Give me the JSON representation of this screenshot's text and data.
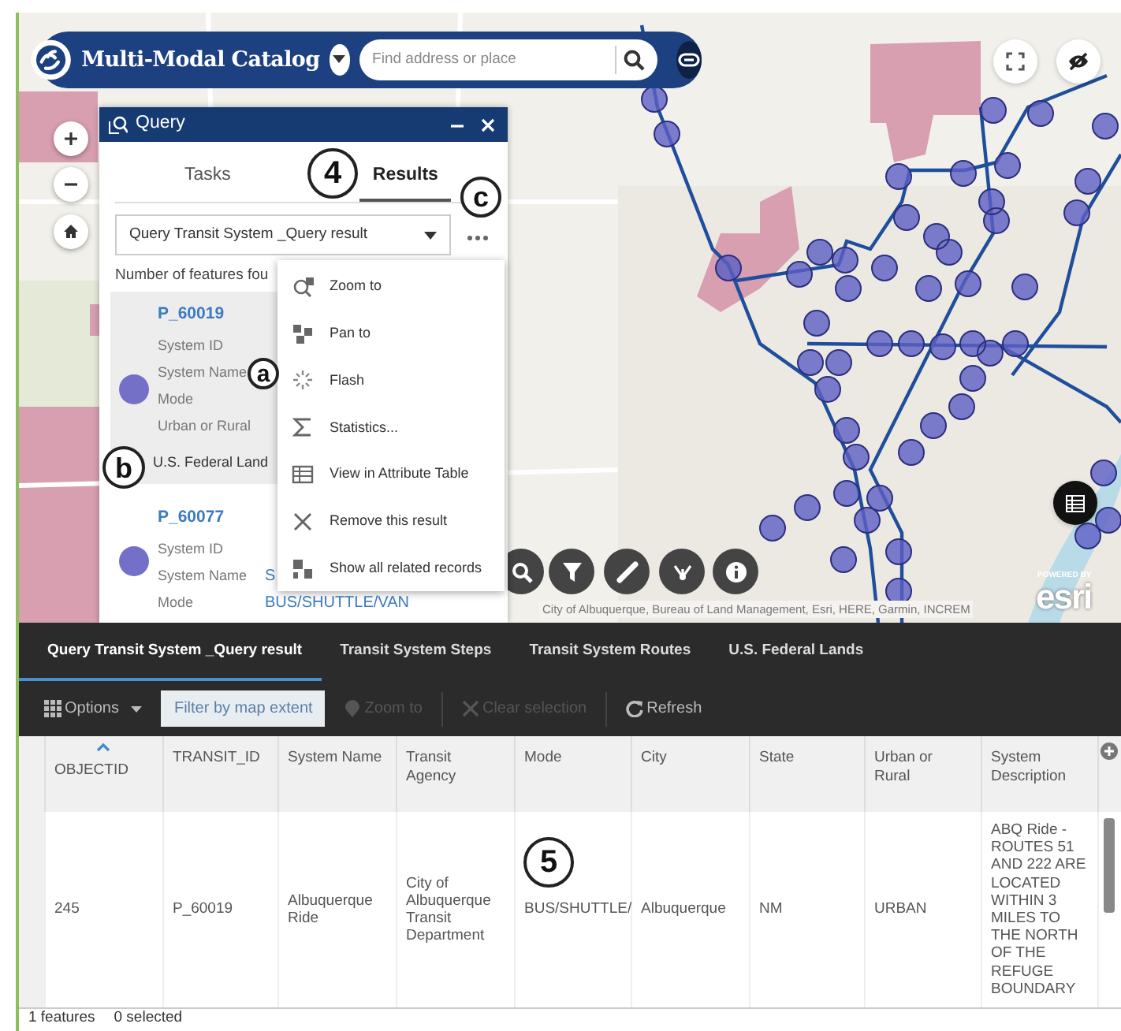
{
  "header": {
    "title": "Multi-Modal Catalog",
    "search": {
      "placeholder": "Find address or place"
    }
  },
  "query_panel": {
    "title": "Query",
    "tabs": [
      {
        "label": "Tasks",
        "selected": false
      },
      {
        "label": "Results",
        "selected": true
      }
    ],
    "result_select": "Query Transit System _Query result",
    "features_count": "Number of features fou",
    "results": [
      {
        "title": "P_60019",
        "selected": true,
        "fields": [
          {
            "label": "System ID"
          },
          {
            "label": "System Name"
          },
          {
            "label": "Mode"
          },
          {
            "label": "Urban or Rural"
          }
        ],
        "related": "U.S. Federal Land"
      },
      {
        "title": "P_60077",
        "selected": false,
        "fields": [
          {
            "label": "System ID"
          },
          {
            "label": "System Name",
            "value": "S"
          },
          {
            "label": "Mode",
            "value": "BUS/SHUTTLE/VAN"
          }
        ]
      }
    ]
  },
  "context_menu": [
    "Zoom to",
    "Pan to",
    "Flash",
    "Statistics...",
    "View in Attribute Table",
    "Remove this result",
    "Show all related records"
  ],
  "map": {
    "attribution": "City of Albuquerque, Bureau of Land Management, Esri, HERE, Garmin, INCREM",
    "logo": {
      "caption": "POWERED BY",
      "name": "esri"
    }
  },
  "callouts": [
    {
      "label": "4"
    },
    {
      "label": "c"
    },
    {
      "label": "a"
    },
    {
      "label": "b"
    },
    {
      "label": "5"
    }
  ],
  "attribute_table": {
    "tabs": [
      {
        "label": "Query Transit System _Query result",
        "selected": true
      },
      {
        "label": "Transit System Steps",
        "selected": false
      },
      {
        "label": "Transit System Routes",
        "selected": false
      },
      {
        "label": "U.S. Federal Lands",
        "selected": false
      }
    ],
    "toolbar": [
      {
        "label": "Options",
        "kind": "menu",
        "disabled": false
      },
      {
        "label": "Filter by map extent",
        "kind": "toggle",
        "disabled": false
      },
      {
        "label": "Zoom to",
        "kind": "zoom",
        "disabled": true
      },
      {
        "label": "Clear selection",
        "kind": "clear",
        "disabled": true
      },
      {
        "label": "Refresh",
        "kind": "refresh",
        "disabled": false
      }
    ],
    "columns": [
      {
        "label": "OBJECTID",
        "sorted": true
      },
      {
        "label": "TRANSIT_ID",
        "sorted": false
      },
      {
        "label": "System Name",
        "sorted": false
      },
      {
        "label": "Transit Agency",
        "sorted": false
      },
      {
        "label": "Mode",
        "sorted": false
      },
      {
        "label": "City",
        "sorted": false
      },
      {
        "label": "State",
        "sorted": false
      },
      {
        "label": "Urban or Rural",
        "sorted": false
      },
      {
        "label": "System Description",
        "sorted": false
      }
    ],
    "rows": [
      [
        "245",
        "P_60019",
        "Albuquerque Ride",
        "City of Albuquerque Transit Department",
        "BUS/SHUTTLE/",
        "Albuquerque",
        "NM",
        "URBAN",
        "ABQ Ride - ROUTES 51 AND 222 ARE LOCATED WITHIN 3 MILES TO THE NORTH OF THE REFUGE BOUNDARY"
      ]
    ],
    "status": {
      "features": "1 features",
      "selected": "0 selected"
    }
  }
}
